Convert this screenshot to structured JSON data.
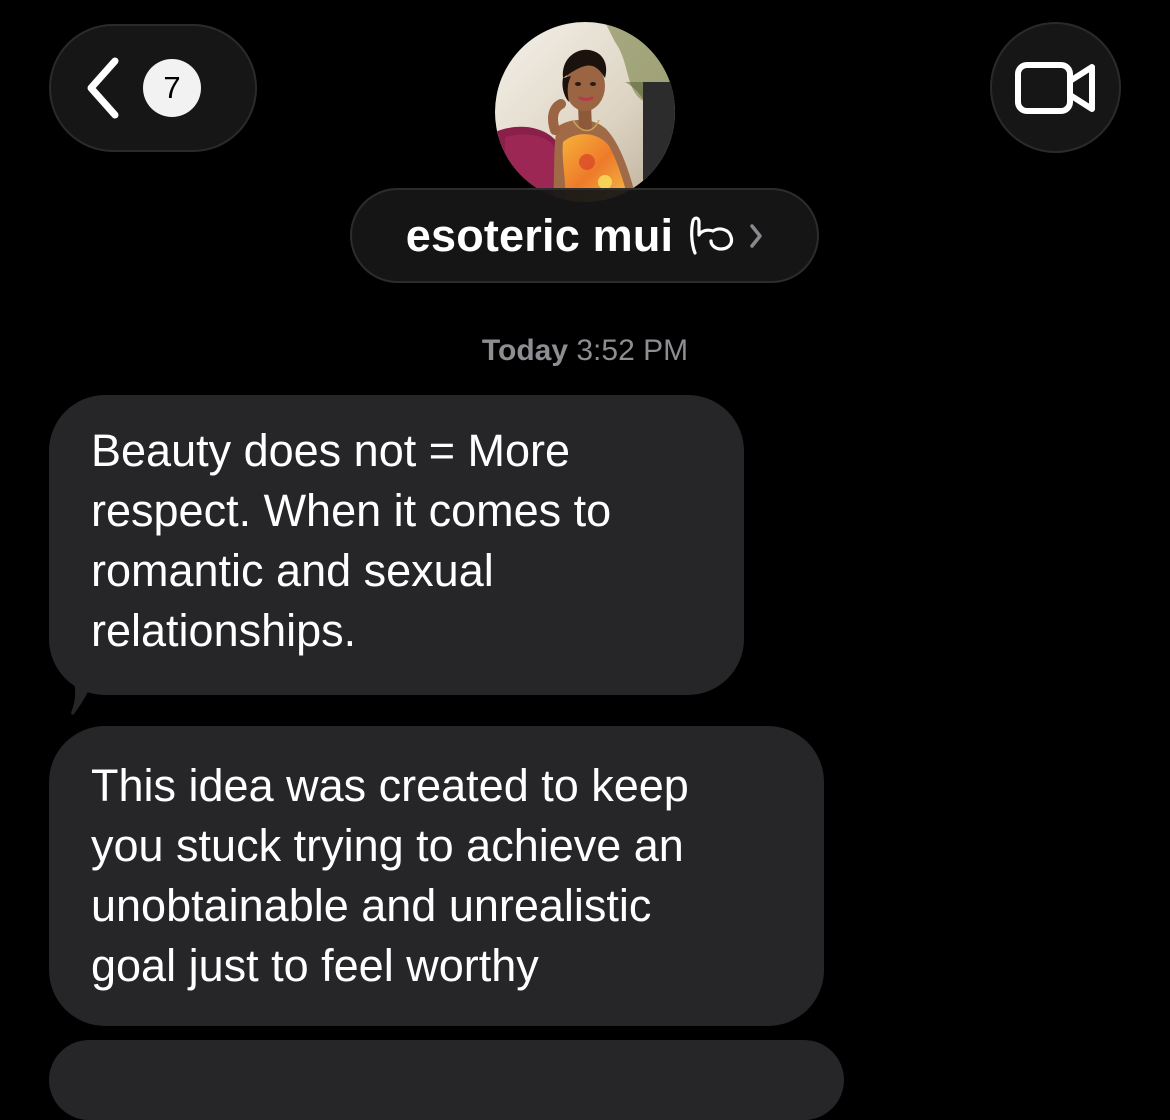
{
  "header": {
    "unread_count": "7",
    "contact_name": "esoteric mui",
    "back_icon": "chevron-left-icon",
    "video_icon": "video-camera-icon",
    "name_emoji": "hand-emoji"
  },
  "timestamp": {
    "day": "Today",
    "time": "3:52 PM"
  },
  "messages": [
    {
      "lines": [
        "Beauty does not = More",
        "respect. When it comes to",
        "romantic and sexual",
        "relationships."
      ]
    },
    {
      "lines": [
        "This idea was created to keep",
        "you stuck trying to achieve an",
        "unobtainable and unrealistic",
        "goal just to feel worthy"
      ]
    }
  ],
  "colors": {
    "background": "#000000",
    "bubble": "#262629",
    "timestamp": "#8d8d92",
    "badge": "#f2f2f2"
  }
}
